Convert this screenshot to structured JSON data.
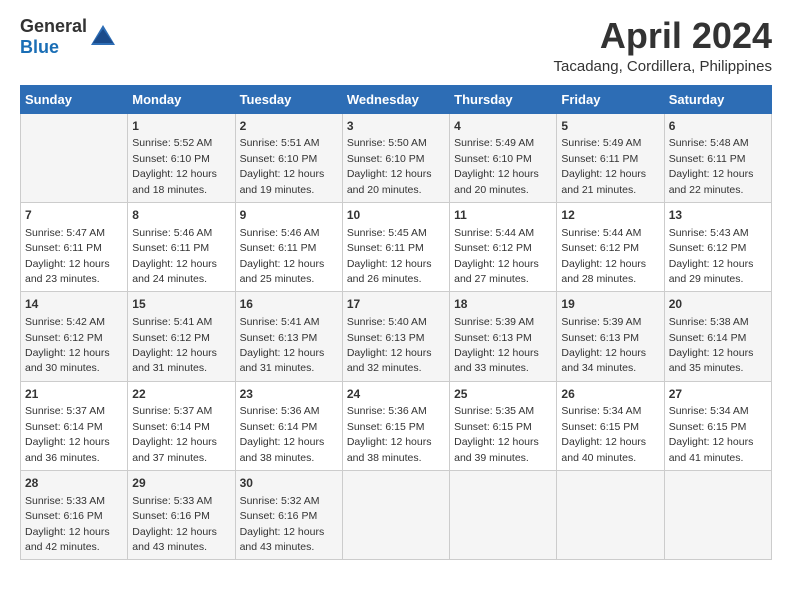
{
  "header": {
    "logo_general": "General",
    "logo_blue": "Blue",
    "title": "April 2024",
    "subtitle": "Tacadang, Cordillera, Philippines"
  },
  "columns": [
    "Sunday",
    "Monday",
    "Tuesday",
    "Wednesday",
    "Thursday",
    "Friday",
    "Saturday"
  ],
  "weeks": [
    [
      {
        "day": "",
        "info": ""
      },
      {
        "day": "1",
        "info": "Sunrise: 5:52 AM\nSunset: 6:10 PM\nDaylight: 12 hours\nand 18 minutes."
      },
      {
        "day": "2",
        "info": "Sunrise: 5:51 AM\nSunset: 6:10 PM\nDaylight: 12 hours\nand 19 minutes."
      },
      {
        "day": "3",
        "info": "Sunrise: 5:50 AM\nSunset: 6:10 PM\nDaylight: 12 hours\nand 20 minutes."
      },
      {
        "day": "4",
        "info": "Sunrise: 5:49 AM\nSunset: 6:10 PM\nDaylight: 12 hours\nand 20 minutes."
      },
      {
        "day": "5",
        "info": "Sunrise: 5:49 AM\nSunset: 6:11 PM\nDaylight: 12 hours\nand 21 minutes."
      },
      {
        "day": "6",
        "info": "Sunrise: 5:48 AM\nSunset: 6:11 PM\nDaylight: 12 hours\nand 22 minutes."
      }
    ],
    [
      {
        "day": "7",
        "info": "Sunrise: 5:47 AM\nSunset: 6:11 PM\nDaylight: 12 hours\nand 23 minutes."
      },
      {
        "day": "8",
        "info": "Sunrise: 5:46 AM\nSunset: 6:11 PM\nDaylight: 12 hours\nand 24 minutes."
      },
      {
        "day": "9",
        "info": "Sunrise: 5:46 AM\nSunset: 6:11 PM\nDaylight: 12 hours\nand 25 minutes."
      },
      {
        "day": "10",
        "info": "Sunrise: 5:45 AM\nSunset: 6:11 PM\nDaylight: 12 hours\nand 26 minutes."
      },
      {
        "day": "11",
        "info": "Sunrise: 5:44 AM\nSunset: 6:12 PM\nDaylight: 12 hours\nand 27 minutes."
      },
      {
        "day": "12",
        "info": "Sunrise: 5:44 AM\nSunset: 6:12 PM\nDaylight: 12 hours\nand 28 minutes."
      },
      {
        "day": "13",
        "info": "Sunrise: 5:43 AM\nSunset: 6:12 PM\nDaylight: 12 hours\nand 29 minutes."
      }
    ],
    [
      {
        "day": "14",
        "info": "Sunrise: 5:42 AM\nSunset: 6:12 PM\nDaylight: 12 hours\nand 30 minutes."
      },
      {
        "day": "15",
        "info": "Sunrise: 5:41 AM\nSunset: 6:12 PM\nDaylight: 12 hours\nand 31 minutes."
      },
      {
        "day": "16",
        "info": "Sunrise: 5:41 AM\nSunset: 6:13 PM\nDaylight: 12 hours\nand 31 minutes."
      },
      {
        "day": "17",
        "info": "Sunrise: 5:40 AM\nSunset: 6:13 PM\nDaylight: 12 hours\nand 32 minutes."
      },
      {
        "day": "18",
        "info": "Sunrise: 5:39 AM\nSunset: 6:13 PM\nDaylight: 12 hours\nand 33 minutes."
      },
      {
        "day": "19",
        "info": "Sunrise: 5:39 AM\nSunset: 6:13 PM\nDaylight: 12 hours\nand 34 minutes."
      },
      {
        "day": "20",
        "info": "Sunrise: 5:38 AM\nSunset: 6:14 PM\nDaylight: 12 hours\nand 35 minutes."
      }
    ],
    [
      {
        "day": "21",
        "info": "Sunrise: 5:37 AM\nSunset: 6:14 PM\nDaylight: 12 hours\nand 36 minutes."
      },
      {
        "day": "22",
        "info": "Sunrise: 5:37 AM\nSunset: 6:14 PM\nDaylight: 12 hours\nand 37 minutes."
      },
      {
        "day": "23",
        "info": "Sunrise: 5:36 AM\nSunset: 6:14 PM\nDaylight: 12 hours\nand 38 minutes."
      },
      {
        "day": "24",
        "info": "Sunrise: 5:36 AM\nSunset: 6:15 PM\nDaylight: 12 hours\nand 38 minutes."
      },
      {
        "day": "25",
        "info": "Sunrise: 5:35 AM\nSunset: 6:15 PM\nDaylight: 12 hours\nand 39 minutes."
      },
      {
        "day": "26",
        "info": "Sunrise: 5:34 AM\nSunset: 6:15 PM\nDaylight: 12 hours\nand 40 minutes."
      },
      {
        "day": "27",
        "info": "Sunrise: 5:34 AM\nSunset: 6:15 PM\nDaylight: 12 hours\nand 41 minutes."
      }
    ],
    [
      {
        "day": "28",
        "info": "Sunrise: 5:33 AM\nSunset: 6:16 PM\nDaylight: 12 hours\nand 42 minutes."
      },
      {
        "day": "29",
        "info": "Sunrise: 5:33 AM\nSunset: 6:16 PM\nDaylight: 12 hours\nand 43 minutes."
      },
      {
        "day": "30",
        "info": "Sunrise: 5:32 AM\nSunset: 6:16 PM\nDaylight: 12 hours\nand 43 minutes."
      },
      {
        "day": "",
        "info": ""
      },
      {
        "day": "",
        "info": ""
      },
      {
        "day": "",
        "info": ""
      },
      {
        "day": "",
        "info": ""
      }
    ]
  ]
}
